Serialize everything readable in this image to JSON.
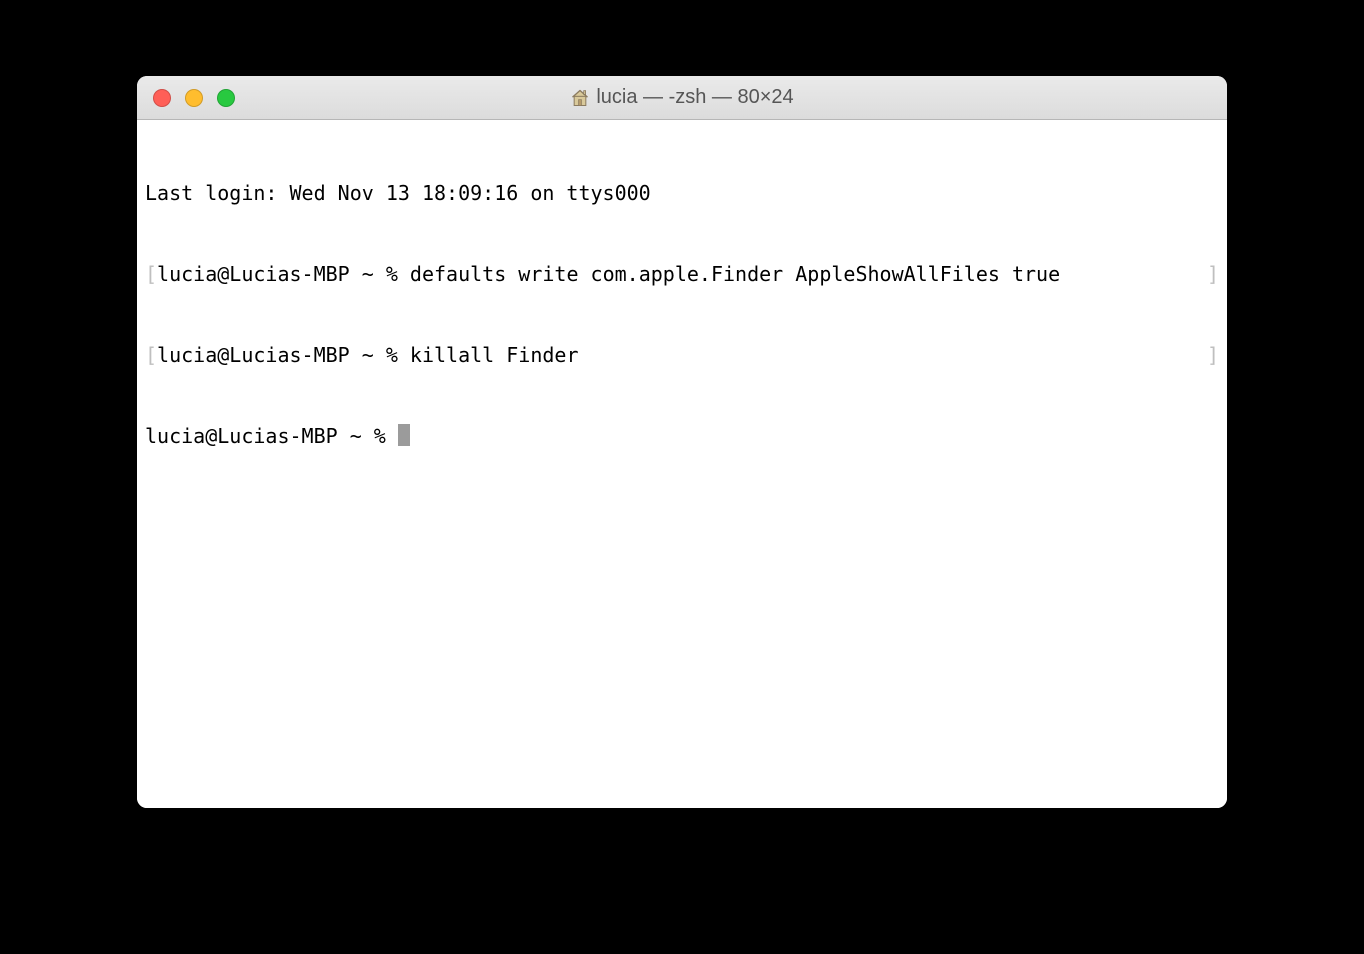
{
  "window": {
    "title": "lucia — -zsh — 80×24"
  },
  "terminal": {
    "last_login": "Last login: Wed Nov 13 18:09:16 on ttys000",
    "prompt": "lucia@Lucias-MBP ~ % ",
    "lines": [
      {
        "cmd": "defaults write com.apple.Finder AppleShowAllFiles true"
      },
      {
        "cmd": "killall Finder"
      }
    ]
  }
}
